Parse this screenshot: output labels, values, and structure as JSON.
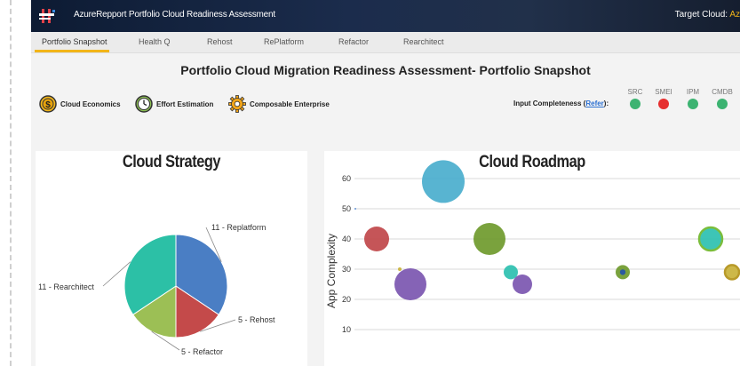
{
  "header": {
    "app_title": "AzureRepport Portfolio Cloud Readiness Assessment",
    "target_cloud_label": "Target Cloud:",
    "target_cloud_value": "Az"
  },
  "tabs": [
    {
      "label": "Portfolio Snapshot",
      "active": true
    },
    {
      "label": "Health Q",
      "active": false
    },
    {
      "label": "Rehost",
      "active": false
    },
    {
      "label": "RePlatform",
      "active": false
    },
    {
      "label": "Refactor",
      "active": false
    },
    {
      "label": "Rearchitect",
      "active": false
    }
  ],
  "page_title": "Portfolio Cloud Migration Readiness Assessment- Portfolio Snapshot",
  "legend": [
    {
      "label": "Cloud Economics",
      "icon": "dollar-coin-icon"
    },
    {
      "label": "Effort Estimation",
      "icon": "clock-icon"
    },
    {
      "label": "Composable Enterprise",
      "icon": "gear-icon"
    }
  ],
  "input_completeness": {
    "label": "Input Completeness (",
    "refer_label": "Refer",
    "suffix": "):",
    "sources": [
      {
        "name": "SRC",
        "color": "#3cb371"
      },
      {
        "name": "SMEI",
        "color": "#e62f2f"
      },
      {
        "name": "IPM",
        "color": "#3cb371"
      },
      {
        "name": "CMDB",
        "color": "#3cb371"
      }
    ]
  },
  "chart_data": [
    {
      "type": "pie",
      "title": "Cloud Strategy",
      "slices": [
        {
          "label": "11 - Replatform",
          "value": 11,
          "color": "#4a7ec4"
        },
        {
          "label": "5 - Rehost",
          "value": 5,
          "color": "#c44a4a"
        },
        {
          "label": "5 - Refactor",
          "value": 5,
          "color": "#9cbf55"
        },
        {
          "label": "11 - Rearchitect",
          "value": 11,
          "color": "#2cc0a6"
        }
      ]
    },
    {
      "type": "scatter",
      "title": "Cloud Roadmap",
      "ylabel": "App Complexity",
      "ylim": [
        0,
        60
      ],
      "yticks": [
        10,
        20,
        30,
        40,
        50,
        60
      ],
      "grid": true,
      "points": [
        {
          "x": 1,
          "y": 50,
          "r": 1,
          "color": "#5b8dd6"
        },
        {
          "x": 2,
          "y": 40,
          "r": 14,
          "color": "#c0474a"
        },
        {
          "x": 3,
          "y": 30,
          "r": 2,
          "color": "#c9b23a"
        },
        {
          "x": 4,
          "y": 25,
          "r": 18,
          "color": "#7b56b0"
        },
        {
          "x": 5,
          "y": 59,
          "r": 24,
          "color": "#4aaecd"
        },
        {
          "x": 6,
          "y": 40,
          "r": 18,
          "color": "#6f9a2c"
        },
        {
          "x": 7,
          "y": 29,
          "r": 8,
          "color": "#2cc0b0"
        },
        {
          "x": 8,
          "y": 25,
          "r": 11,
          "color": "#7b56b0"
        },
        {
          "x": 9,
          "y": 29,
          "r": 8,
          "color": "#6f9a2c",
          "inner": "#2b5aa0"
        },
        {
          "x": 10,
          "y": 40,
          "r": 13,
          "color": "#2cc0b0",
          "ring": "#7bbd3c"
        },
        {
          "x": 11,
          "y": 29,
          "r": 8,
          "color": "#c9b23a",
          "ring": "#b89a2a"
        }
      ]
    }
  ]
}
